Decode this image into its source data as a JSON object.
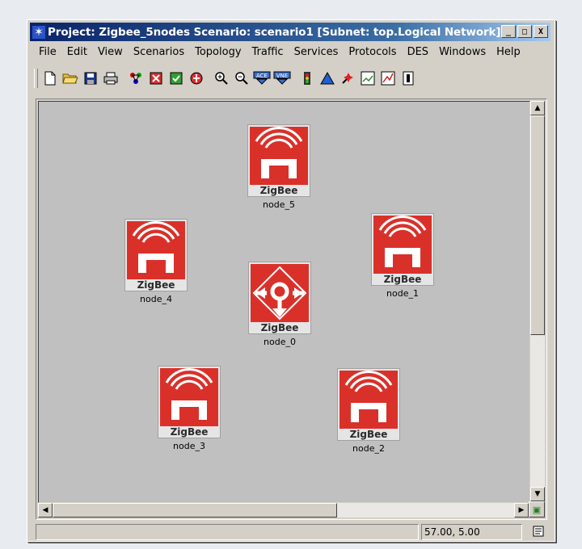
{
  "window": {
    "title": "Project: Zigbee_5nodes Scenario: scenario1  [Subnet: top.Logical Network]",
    "buttons": [
      "_",
      "□",
      "X"
    ]
  },
  "menu": [
    "File",
    "Edit",
    "View",
    "Scenarios",
    "Topology",
    "Traffic",
    "Services",
    "Protocols",
    "DES",
    "Windows",
    "Help"
  ],
  "toolbar": [
    {
      "icon": "new-project-icon",
      "glyph": "🗋"
    },
    {
      "icon": "open-folder-icon",
      "glyph": "📂"
    },
    {
      "icon": "save-icon",
      "glyph": "💾"
    },
    {
      "icon": "print-icon",
      "glyph": "🖶"
    },
    {
      "icon": "object-palette-icon",
      "glyph": "✲"
    },
    {
      "icon": "failure-icon",
      "glyph": "▣"
    },
    {
      "icon": "recovery-icon",
      "glyph": "▣"
    },
    {
      "icon": "route-icon",
      "glyph": "●"
    },
    {
      "icon": "zoom-in-icon",
      "glyph": "⊕"
    },
    {
      "icon": "zoom-out-icon",
      "glyph": "⊖"
    },
    {
      "icon": "ace-import-icon",
      "glyph": "ACE"
    },
    {
      "icon": "vne-icon",
      "glyph": "VNE"
    },
    {
      "icon": "traffic-light-icon",
      "glyph": "▮"
    },
    {
      "icon": "triangle-icon",
      "glyph": "▲"
    },
    {
      "icon": "run-simulation-icon",
      "glyph": "✦"
    },
    {
      "icon": "results-icon",
      "glyph": "▤"
    },
    {
      "icon": "graph-icon",
      "glyph": "◪"
    },
    {
      "icon": "hide-graphs-icon",
      "glyph": "▯"
    }
  ],
  "nodes": [
    {
      "brand": "ZigBee",
      "label": "node_5",
      "type": "end-device"
    },
    {
      "brand": "ZigBee",
      "label": "node_4",
      "type": "end-device"
    },
    {
      "brand": "ZigBee",
      "label": "node_0",
      "type": "coordinator"
    },
    {
      "brand": "ZigBee",
      "label": "node_1",
      "type": "end-device"
    },
    {
      "brand": "ZigBee",
      "label": "node_3",
      "type": "end-device"
    },
    {
      "brand": "ZigBee",
      "label": "node_2",
      "type": "end-device"
    }
  ],
  "status": {
    "coordinates": "57.00, 5.00"
  },
  "colors": {
    "title_bar": "#0a246a",
    "zigbee_red": "#d9312a",
    "canvas": "#c0c0c0"
  }
}
